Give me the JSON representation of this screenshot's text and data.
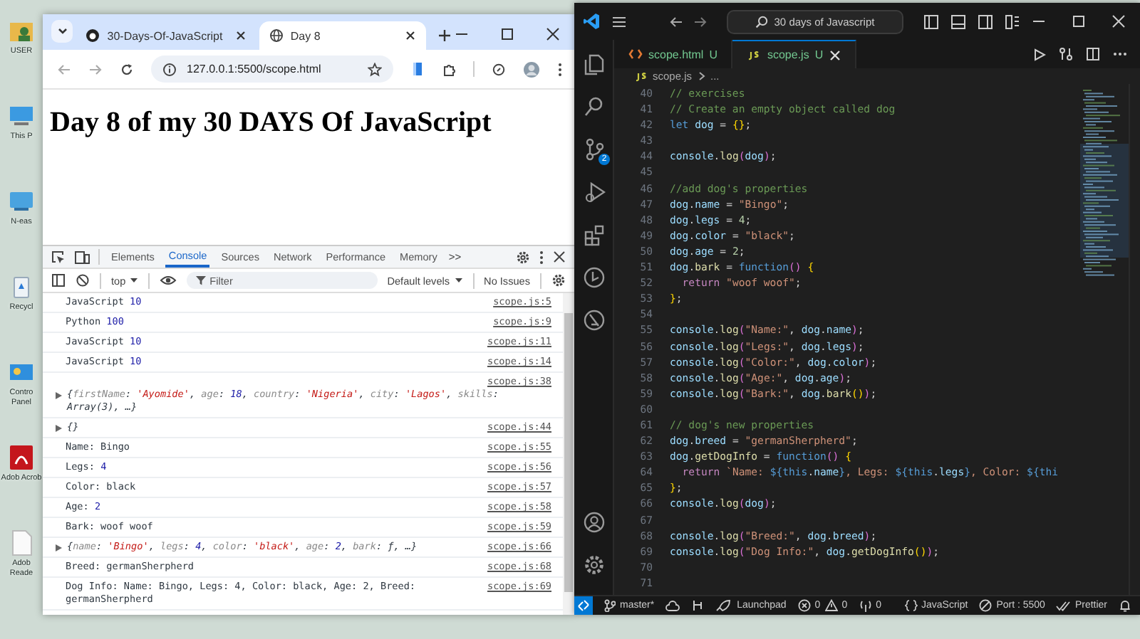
{
  "desktop": {
    "icons": [
      {
        "kind": "folder",
        "label": "USER"
      },
      {
        "kind": "computer",
        "label": "This P"
      },
      {
        "kind": "network",
        "label": "N-eas"
      },
      {
        "kind": "recycle",
        "label": "Recycl"
      },
      {
        "kind": "control",
        "label": "Contro Panel"
      },
      {
        "kind": "pdf",
        "label": "Adob Acrob"
      },
      {
        "kind": "document",
        "label": "Adob Reade"
      }
    ]
  },
  "browser": {
    "tabs": [
      {
        "title": "30-Days-Of-JavaScript",
        "kind": "github",
        "selected": false
      },
      {
        "title": "Day 8",
        "kind": "globe",
        "selected": true
      }
    ],
    "url": "127.0.0.1:5500/scope.html",
    "page": {
      "heading": "Day 8 of my 30 DAYS Of JavaScript"
    },
    "devtools": {
      "tabs": [
        {
          "label": "Elements",
          "selected": false
        },
        {
          "label": "Console",
          "selected": true
        },
        {
          "label": "Sources",
          "selected": false
        },
        {
          "label": "Network",
          "selected": false
        },
        {
          "label": "Performance",
          "selected": false
        },
        {
          "label": "Memory",
          "selected": false
        }
      ],
      "more": ">>",
      "context": "top",
      "filter": {
        "placeholder": "Filter"
      },
      "levels": "Default levels",
      "issues": "No Issues",
      "logs": [
        {
          "kind": "text",
          "source": "scope.js:5",
          "message": [
            {
              "text": "JavaScript ",
              "kind": "plain"
            },
            {
              "text": "10",
              "kind": "number"
            }
          ]
        },
        {
          "kind": "text",
          "source": "scope.js:9",
          "message": [
            {
              "text": "Python ",
              "kind": "plain"
            },
            {
              "text": "100",
              "kind": "number"
            }
          ]
        },
        {
          "kind": "text",
          "source": "scope.js:11",
          "message": [
            {
              "text": "JavaScript ",
              "kind": "plain"
            },
            {
              "text": "10",
              "kind": "number"
            }
          ]
        },
        {
          "kind": "text",
          "source": "scope.js:14",
          "message": [
            {
              "text": "JavaScript ",
              "kind": "plain"
            },
            {
              "text": "10",
              "kind": "number"
            }
          ]
        },
        {
          "kind": "stacked",
          "source": "scope.js:38",
          "message": [
            {
              "text": "{",
              "kind": "plain"
            },
            {
              "text": "firstName",
              "kind": "key"
            },
            {
              "text": ": ",
              "kind": "plain"
            },
            {
              "text": "'Ayomide'",
              "kind": "string"
            },
            {
              "text": ", ",
              "kind": "plain"
            },
            {
              "text": "age",
              "kind": "key"
            },
            {
              "text": ": ",
              "kind": "plain"
            },
            {
              "text": "18",
              "kind": "number"
            },
            {
              "text": ", ",
              "kind": "plain"
            },
            {
              "text": "country",
              "kind": "key"
            },
            {
              "text": ": ",
              "kind": "plain"
            },
            {
              "text": "'Nigeria'",
              "kind": "string"
            },
            {
              "text": ", ",
              "kind": "plain"
            },
            {
              "text": "city",
              "kind": "key"
            },
            {
              "text": ": ",
              "kind": "plain"
            },
            {
              "text": "'Lagos'",
              "kind": "string"
            },
            {
              "text": ", ",
              "kind": "plain"
            },
            {
              "text": "skills",
              "kind": "key"
            },
            {
              "text": ": ",
              "kind": "plain"
            },
            {
              "text": "Array(3)",
              "kind": "plain"
            },
            {
              "text": ", …}",
              "kind": "plain"
            }
          ]
        },
        {
          "kind": "object",
          "source": "scope.js:44",
          "message": [
            {
              "text": "{}",
              "kind": "plain"
            }
          ]
        },
        {
          "kind": "text",
          "source": "scope.js:55",
          "message": [
            {
              "text": "Name: Bingo",
              "kind": "plain"
            }
          ]
        },
        {
          "kind": "text",
          "source": "scope.js:56",
          "message": [
            {
              "text": "Legs: ",
              "kind": "plain"
            },
            {
              "text": "4",
              "kind": "number"
            }
          ]
        },
        {
          "kind": "text",
          "source": "scope.js:57",
          "message": [
            {
              "text": "Color: black",
              "kind": "plain"
            }
          ]
        },
        {
          "kind": "text",
          "source": "scope.js:58",
          "message": [
            {
              "text": "Age: ",
              "kind": "plain"
            },
            {
              "text": "2",
              "kind": "number"
            }
          ]
        },
        {
          "kind": "text",
          "source": "scope.js:59",
          "message": [
            {
              "text": "Bark: woof woof",
              "kind": "plain"
            }
          ]
        },
        {
          "kind": "object",
          "source": "scope.js:66",
          "message": [
            {
              "text": "{",
              "kind": "plain"
            },
            {
              "text": "name",
              "kind": "key"
            },
            {
              "text": ": ",
              "kind": "plain"
            },
            {
              "text": "'Bingo'",
              "kind": "string"
            },
            {
              "text": ", ",
              "kind": "plain"
            },
            {
              "text": "legs",
              "kind": "key"
            },
            {
              "text": ": ",
              "kind": "plain"
            },
            {
              "text": "4",
              "kind": "number"
            },
            {
              "text": ", ",
              "kind": "plain"
            },
            {
              "text": "color",
              "kind": "key"
            },
            {
              "text": ": ",
              "kind": "plain"
            },
            {
              "text": "'black'",
              "kind": "string"
            },
            {
              "text": ", ",
              "kind": "plain"
            },
            {
              "text": "age",
              "kind": "key"
            },
            {
              "text": ": ",
              "kind": "plain"
            },
            {
              "text": "2",
              "kind": "number"
            },
            {
              "text": ", ",
              "kind": "plain"
            },
            {
              "text": "bark",
              "kind": "key"
            },
            {
              "text": ": ",
              "kind": "plain"
            },
            {
              "text": "ƒ",
              "kind": "plain"
            },
            {
              "text": ", …}",
              "kind": "plain"
            }
          ]
        },
        {
          "kind": "text",
          "source": "scope.js:68",
          "message": [
            {
              "text": "Breed: germanSherpherd",
              "kind": "plain"
            }
          ]
        },
        {
          "kind": "text",
          "source": "scope.js:69",
          "message": [
            {
              "text": "Dog Info: Name: Bingo, Legs: 4, Color: black, Age: 2, Breed: germanSherpherd",
              "kind": "plain"
            }
          ]
        }
      ]
    }
  },
  "editor": {
    "search": "30 days of Javascript",
    "badge": "2",
    "tabs": [
      {
        "name": "scope.html",
        "status": "U",
        "kind": "html",
        "selected": false
      },
      {
        "name": "scope.js",
        "status": "U",
        "kind": "js",
        "selected": true
      }
    ],
    "breadcrumb": [
      "scope.js",
      "..."
    ],
    "lines": [
      {
        "number": "40",
        "tokens": [
          {
            "text": "// exercises",
            "kind": "comment"
          }
        ]
      },
      {
        "number": "41",
        "tokens": [
          {
            "text": "// Create an empty object called dog",
            "kind": "comment"
          }
        ]
      },
      {
        "number": "42",
        "tokens": [
          {
            "text": "let ",
            "kind": "keyword"
          },
          {
            "text": "dog",
            "kind": "variable"
          },
          {
            "text": " = ",
            "kind": "plain"
          },
          {
            "text": "{}",
            "kind": "brace"
          },
          {
            "text": ";",
            "kind": "plain"
          }
        ]
      },
      {
        "number": "43"
      },
      {
        "number": "44",
        "tokens": [
          {
            "text": "console",
            "kind": "variable"
          },
          {
            "text": ".",
            "kind": "plain"
          },
          {
            "text": "log",
            "kind": "function"
          },
          {
            "text": "(",
            "kind": "paren"
          },
          {
            "text": "dog",
            "kind": "variable"
          },
          {
            "text": ")",
            "kind": "paren"
          },
          {
            "text": ";",
            "kind": "plain"
          }
        ]
      },
      {
        "number": "45"
      },
      {
        "number": "46",
        "tokens": [
          {
            "text": "//add dog's properties",
            "kind": "comment"
          }
        ]
      },
      {
        "number": "47",
        "tokens": [
          {
            "text": "dog",
            "kind": "variable"
          },
          {
            "text": ".",
            "kind": "plain"
          },
          {
            "text": "name",
            "kind": "variable"
          },
          {
            "text": " = ",
            "kind": "plain"
          },
          {
            "text": "\"Bingo\"",
            "kind": "string"
          },
          {
            "text": ";",
            "kind": "plain"
          }
        ]
      },
      {
        "number": "48",
        "tokens": [
          {
            "text": "dog",
            "kind": "variable"
          },
          {
            "text": ".",
            "kind": "plain"
          },
          {
            "text": "legs",
            "kind": "variable"
          },
          {
            "text": " = ",
            "kind": "plain"
          },
          {
            "text": "4",
            "kind": "number"
          },
          {
            "text": ";",
            "kind": "plain"
          }
        ]
      },
      {
        "number": "49",
        "tokens": [
          {
            "text": "dog",
            "kind": "variable"
          },
          {
            "text": ".",
            "kind": "plain"
          },
          {
            "text": "color",
            "kind": "variable"
          },
          {
            "text": " = ",
            "kind": "plain"
          },
          {
            "text": "\"black\"",
            "kind": "string"
          },
          {
            "text": ";",
            "kind": "plain"
          }
        ]
      },
      {
        "number": "50",
        "tokens": [
          {
            "text": "dog",
            "kind": "variable"
          },
          {
            "text": ".",
            "kind": "plain"
          },
          {
            "text": "age",
            "kind": "variable"
          },
          {
            "text": " = ",
            "kind": "plain"
          },
          {
            "text": "2",
            "kind": "number"
          },
          {
            "text": ";",
            "kind": "plain"
          }
        ]
      },
      {
        "number": "51",
        "tokens": [
          {
            "text": "dog",
            "kind": "variable"
          },
          {
            "text": ".",
            "kind": "plain"
          },
          {
            "text": "bark",
            "kind": "function"
          },
          {
            "text": " = ",
            "kind": "plain"
          },
          {
            "text": "function",
            "kind": "keyword"
          },
          {
            "text": "()",
            "kind": "paren"
          },
          {
            "text": " {",
            "kind": "brace"
          }
        ]
      },
      {
        "number": "52",
        "tokens": [
          {
            "text": "  return ",
            "kind": "control"
          },
          {
            "text": "\"woof woof\"",
            "kind": "string"
          },
          {
            "text": ";",
            "kind": "plain"
          }
        ]
      },
      {
        "number": "53",
        "tokens": [
          {
            "text": "}",
            "kind": "brace"
          },
          {
            "text": ";",
            "kind": "plain"
          }
        ]
      },
      {
        "number": "54"
      },
      {
        "number": "55",
        "tokens": [
          {
            "text": "console",
            "kind": "variable"
          },
          {
            "text": ".",
            "kind": "plain"
          },
          {
            "text": "log",
            "kind": "function"
          },
          {
            "text": "(",
            "kind": "paren"
          },
          {
            "text": "\"Name:\"",
            "kind": "string"
          },
          {
            "text": ", ",
            "kind": "plain"
          },
          {
            "text": "dog",
            "kind": "variable"
          },
          {
            "text": ".",
            "kind": "plain"
          },
          {
            "text": "name",
            "kind": "variable"
          },
          {
            "text": ")",
            "kind": "paren"
          },
          {
            "text": ";",
            "kind": "plain"
          }
        ]
      },
      {
        "number": "56",
        "tokens": [
          {
            "text": "console",
            "kind": "variable"
          },
          {
            "text": ".",
            "kind": "plain"
          },
          {
            "text": "log",
            "kind": "function"
          },
          {
            "text": "(",
            "kind": "paren"
          },
          {
            "text": "\"Legs:\"",
            "kind": "string"
          },
          {
            "text": ", ",
            "kind": "plain"
          },
          {
            "text": "dog",
            "kind": "variable"
          },
          {
            "text": ".",
            "kind": "plain"
          },
          {
            "text": "legs",
            "kind": "variable"
          },
          {
            "text": ")",
            "kind": "paren"
          },
          {
            "text": ";",
            "kind": "plain"
          }
        ]
      },
      {
        "number": "57",
        "tokens": [
          {
            "text": "console",
            "kind": "variable"
          },
          {
            "text": ".",
            "kind": "plain"
          },
          {
            "text": "log",
            "kind": "function"
          },
          {
            "text": "(",
            "kind": "paren"
          },
          {
            "text": "\"Color:\"",
            "kind": "string"
          },
          {
            "text": ", ",
            "kind": "plain"
          },
          {
            "text": "dog",
            "kind": "variable"
          },
          {
            "text": ".",
            "kind": "plain"
          },
          {
            "text": "color",
            "kind": "variable"
          },
          {
            "text": ")",
            "kind": "paren"
          },
          {
            "text": ";",
            "kind": "plain"
          }
        ]
      },
      {
        "number": "58",
        "tokens": [
          {
            "text": "console",
            "kind": "variable"
          },
          {
            "text": ".",
            "kind": "plain"
          },
          {
            "text": "log",
            "kind": "function"
          },
          {
            "text": "(",
            "kind": "paren"
          },
          {
            "text": "\"Age:\"",
            "kind": "string"
          },
          {
            "text": ", ",
            "kind": "plain"
          },
          {
            "text": "dog",
            "kind": "variable"
          },
          {
            "text": ".",
            "kind": "plain"
          },
          {
            "text": "age",
            "kind": "variable"
          },
          {
            "text": ")",
            "kind": "paren"
          },
          {
            "text": ";",
            "kind": "plain"
          }
        ]
      },
      {
        "number": "59",
        "tokens": [
          {
            "text": "console",
            "kind": "variable"
          },
          {
            "text": ".",
            "kind": "plain"
          },
          {
            "text": "log",
            "kind": "function"
          },
          {
            "text": "(",
            "kind": "paren"
          },
          {
            "text": "\"Bark:\"",
            "kind": "string"
          },
          {
            "text": ", ",
            "kind": "plain"
          },
          {
            "text": "dog",
            "kind": "variable"
          },
          {
            "text": ".",
            "kind": "plain"
          },
          {
            "text": "bark",
            "kind": "function"
          },
          {
            "text": "()",
            "kind": "brace"
          },
          {
            "text": ")",
            "kind": "paren"
          },
          {
            "text": ";",
            "kind": "plain"
          }
        ]
      },
      {
        "number": "60"
      },
      {
        "number": "61",
        "tokens": [
          {
            "text": "// dog's new properties",
            "kind": "comment"
          }
        ]
      },
      {
        "number": "62",
        "tokens": [
          {
            "text": "dog",
            "kind": "variable"
          },
          {
            "text": ".",
            "kind": "plain"
          },
          {
            "text": "breed",
            "kind": "variable"
          },
          {
            "text": " = ",
            "kind": "plain"
          },
          {
            "text": "\"germanSherpherd\"",
            "kind": "string"
          },
          {
            "text": ";",
            "kind": "plain"
          }
        ]
      },
      {
        "number": "63",
        "tokens": [
          {
            "text": "dog",
            "kind": "variable"
          },
          {
            "text": ".",
            "kind": "plain"
          },
          {
            "text": "getDogInfo",
            "kind": "function"
          },
          {
            "text": " = ",
            "kind": "plain"
          },
          {
            "text": "function",
            "kind": "keyword"
          },
          {
            "text": "()",
            "kind": "paren"
          },
          {
            "text": " {",
            "kind": "brace"
          }
        ]
      },
      {
        "number": "64",
        "tokens": [
          {
            "text": "  return ",
            "kind": "control"
          },
          {
            "text": "`Name: ",
            "kind": "string"
          },
          {
            "text": "${",
            "kind": "keyword"
          },
          {
            "text": "this",
            "kind": "keyword"
          },
          {
            "text": ".",
            "kind": "plain"
          },
          {
            "text": "name",
            "kind": "variable"
          },
          {
            "text": "}",
            "kind": "keyword"
          },
          {
            "text": ", Legs: ",
            "kind": "string"
          },
          {
            "text": "${",
            "kind": "keyword"
          },
          {
            "text": "this",
            "kind": "keyword"
          },
          {
            "text": ".",
            "kind": "plain"
          },
          {
            "text": "legs",
            "kind": "variable"
          },
          {
            "text": "}",
            "kind": "keyword"
          },
          {
            "text": ", Color: ",
            "kind": "string"
          },
          {
            "text": "${",
            "kind": "keyword"
          },
          {
            "text": "thi",
            "kind": "keyword"
          }
        ]
      },
      {
        "number": "65",
        "tokens": [
          {
            "text": "}",
            "kind": "brace"
          },
          {
            "text": ";",
            "kind": "plain"
          }
        ]
      },
      {
        "number": "66",
        "tokens": [
          {
            "text": "console",
            "kind": "variable"
          },
          {
            "text": ".",
            "kind": "plain"
          },
          {
            "text": "log",
            "kind": "function"
          },
          {
            "text": "(",
            "kind": "paren"
          },
          {
            "text": "dog",
            "kind": "variable"
          },
          {
            "text": ")",
            "kind": "paren"
          },
          {
            "text": ";",
            "kind": "plain"
          }
        ]
      },
      {
        "number": "67"
      },
      {
        "number": "68",
        "tokens": [
          {
            "text": "console",
            "kind": "variable"
          },
          {
            "text": ".",
            "kind": "plain"
          },
          {
            "text": "log",
            "kind": "function"
          },
          {
            "text": "(",
            "kind": "paren"
          },
          {
            "text": "\"Breed:\"",
            "kind": "string"
          },
          {
            "text": ", ",
            "kind": "plain"
          },
          {
            "text": "dog",
            "kind": "variable"
          },
          {
            "text": ".",
            "kind": "plain"
          },
          {
            "text": "breed",
            "kind": "variable"
          },
          {
            "text": ")",
            "kind": "paren"
          },
          {
            "text": ";",
            "kind": "plain"
          }
        ]
      },
      {
        "number": "69",
        "tokens": [
          {
            "text": "console",
            "kind": "variable"
          },
          {
            "text": ".",
            "kind": "plain"
          },
          {
            "text": "log",
            "kind": "function"
          },
          {
            "text": "(",
            "kind": "paren"
          },
          {
            "text": "\"Dog Info:\"",
            "kind": "string"
          },
          {
            "text": ", ",
            "kind": "plain"
          },
          {
            "text": "dog",
            "kind": "variable"
          },
          {
            "text": ".",
            "kind": "plain"
          },
          {
            "text": "getDogInfo",
            "kind": "function"
          },
          {
            "text": "()",
            "kind": "brace"
          },
          {
            "text": ")",
            "kind": "paren"
          },
          {
            "text": ";",
            "kind": "plain"
          }
        ]
      },
      {
        "number": "70"
      },
      {
        "number": "71"
      }
    ],
    "status": {
      "branch": "master*",
      "launchpad": "Launchpad",
      "errors": "0",
      "warnings": "0",
      "ports": "0",
      "language": "JavaScript",
      "port": "Port : 5500",
      "formatter": "Prettier"
    }
  }
}
